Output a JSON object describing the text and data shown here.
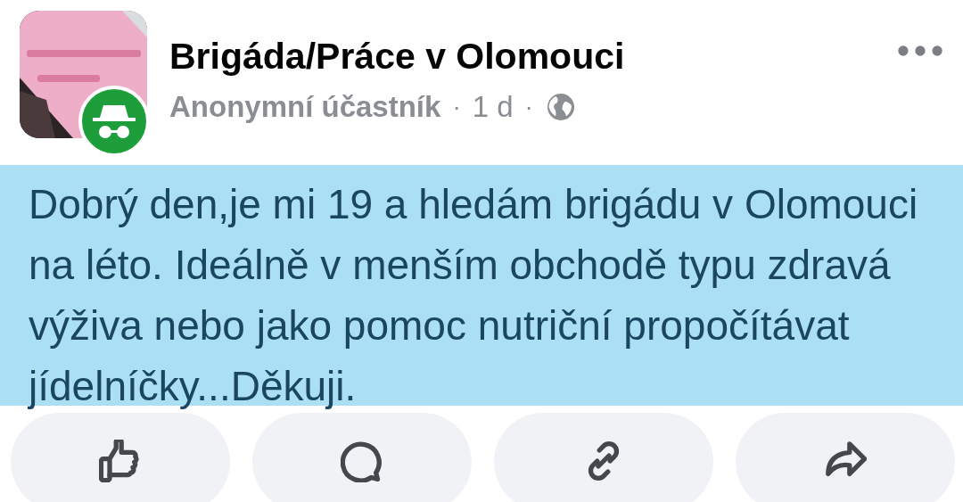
{
  "post": {
    "group_name": "Brigáda/Práce v Olomouci",
    "author": "Anonymní účastník",
    "separator_1": "·",
    "time": "1 d",
    "separator_2": "·",
    "body": "Dobrý den,je mi 19 a hledám brigádu v Olomouci na léto. Ideálně v menším obchodě typu zdravá výživa nebo jako pomoc nutriční propočítávat jídelníčky...Děkuji."
  },
  "actions": [
    {
      "kind": "like"
    },
    {
      "kind": "comment"
    },
    {
      "kind": "link"
    },
    {
      "kind": "share"
    }
  ]
}
